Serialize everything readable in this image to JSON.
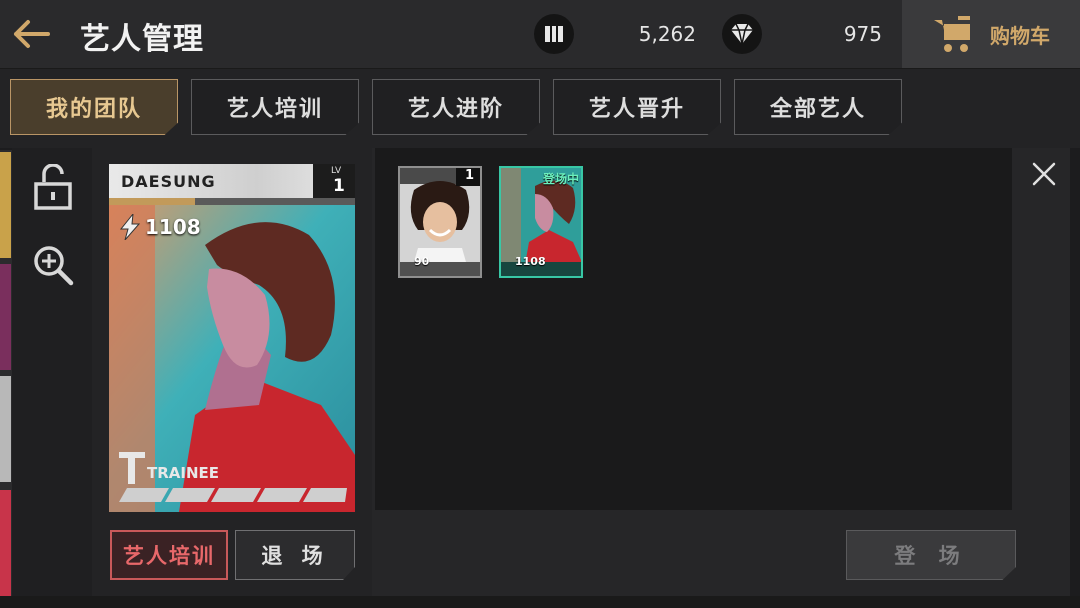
{
  "header": {
    "title": "艺人管理",
    "currency1": {
      "icon": "ticket-icon",
      "value": "5,262"
    },
    "currency2": {
      "icon": "diamond-icon",
      "value": "975"
    },
    "cart_label": "购物车"
  },
  "tabs": [
    {
      "label": "我的团队",
      "active": true
    },
    {
      "label": "艺人培训",
      "active": false
    },
    {
      "label": "艺人进阶",
      "active": false
    },
    {
      "label": "艺人晋升",
      "active": false
    },
    {
      "label": "全部艺人",
      "active": false
    }
  ],
  "detail": {
    "name": "DAESUNG",
    "lv_tag": "LV",
    "level": "1",
    "xp_progress": 0.35,
    "power": "1108",
    "brand": "TRAINEE",
    "train_button": "艺人培训",
    "leave_button": "退 场"
  },
  "cards": [
    {
      "power": "90",
      "level": "1",
      "status": ""
    },
    {
      "power": "1108",
      "level": "",
      "status": "登场中"
    }
  ],
  "deploy_button": "登 场",
  "colors": {
    "accent_gold": "#d1a86a",
    "train_red": "#e8686a",
    "active_teal": "#38c7a5"
  }
}
